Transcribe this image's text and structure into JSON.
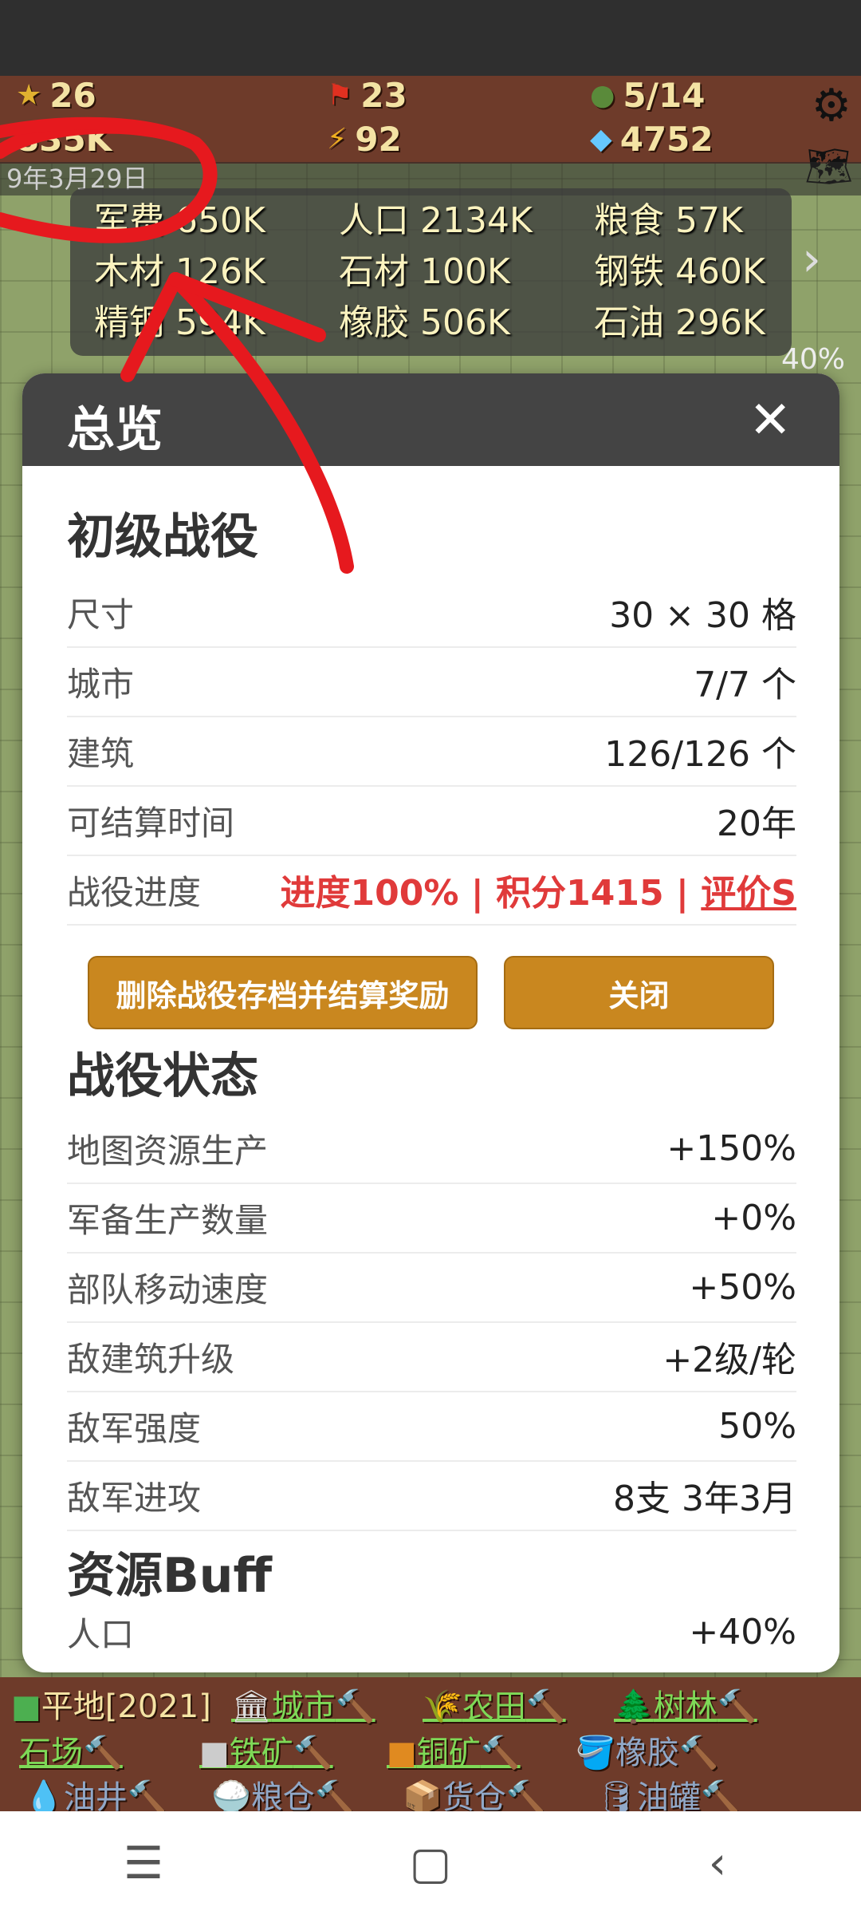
{
  "hud": {
    "medals": "26",
    "flags": "23",
    "troops": "5/14",
    "money": "835K",
    "energy": "92",
    "gems": "4752",
    "date": "9年3月29日"
  },
  "resources": [
    {
      "label": "军费 650K"
    },
    {
      "label": "人口 2134K"
    },
    {
      "label": "粮食 57K"
    },
    {
      "label": "木材 126K"
    },
    {
      "label": "石材 100K"
    },
    {
      "label": "钢铁 460K"
    },
    {
      "label": "精钢 594K"
    },
    {
      "label": "橡胶 506K"
    },
    {
      "label": "石油 296K"
    }
  ],
  "map_overlay": {
    "percent": "40%"
  },
  "modal": {
    "title": "总览",
    "close": "✕",
    "campaign_title": "初级战役",
    "campaign_rows": [
      {
        "label": "尺寸",
        "value": "30 × 30 格"
      },
      {
        "label": "城市",
        "value": "7/7 个"
      },
      {
        "label": "建筑",
        "value": "126/126 个"
      },
      {
        "label": "可结算时间",
        "value": "20年"
      }
    ],
    "progress": {
      "label": "战役进度",
      "text": "进度100% | 积分1415 | ",
      "grade": "评价S"
    },
    "btn_delete": "删除战役存档并结算奖励",
    "btn_close": "关闭",
    "status_title": "战役状态",
    "status_rows": [
      {
        "label": "地图资源生产",
        "value": "+150%"
      },
      {
        "label": "军备生产数量",
        "value": "+0%"
      },
      {
        "label": "部队移动速度",
        "value": "+50%"
      },
      {
        "label": "敌建筑升级",
        "value": "+2级/轮"
      },
      {
        "label": "敌军强度",
        "value": "50%"
      },
      {
        "label": "敌军进攻",
        "value": "8支 3年3月"
      }
    ],
    "buff_title": "资源Buff",
    "buff_rows": [
      {
        "label": "人口",
        "value": "+40%"
      }
    ]
  },
  "legend": {
    "plain": "平地[2021]",
    "items": [
      "城市",
      "农田",
      "树林",
      "石场",
      "铁矿",
      "铜矿",
      "橡胶",
      "油井",
      "粮仓",
      "货仓",
      "油罐"
    ]
  },
  "colors": {
    "accent": "#c9871f",
    "header": "#444444",
    "progress_red": "#e03a3a",
    "legend_green": "#7ed957"
  }
}
